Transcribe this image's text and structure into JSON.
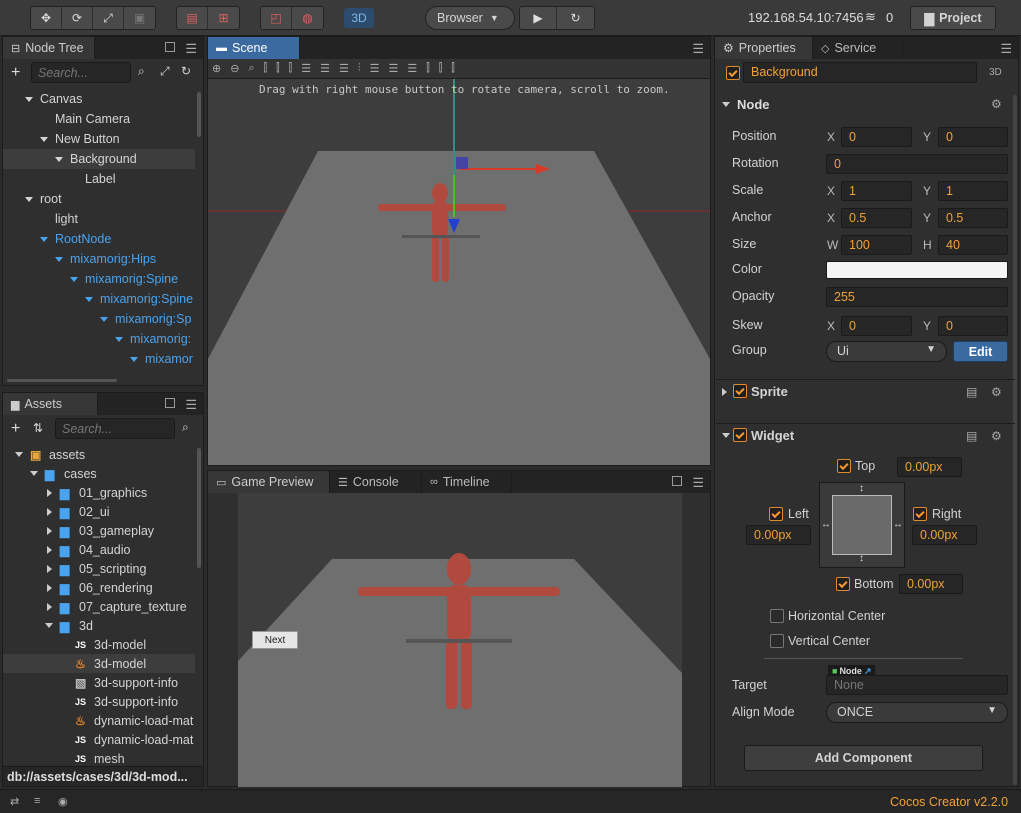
{
  "toolbar": {
    "browser_label": "Browser",
    "mode_3d": "3D",
    "ip": "192.168.54.10:7456",
    "device_count": "0",
    "project_label": "Project"
  },
  "node_tree": {
    "title": "Node Tree",
    "search_placeholder": "Search...",
    "items": [
      {
        "label": "Canvas",
        "depth": 1,
        "arrow": "down",
        "color": "#d4d4d4"
      },
      {
        "label": "Main Camera",
        "depth": 2,
        "arrow": "none",
        "color": "#d4d4d4"
      },
      {
        "label": "New Button",
        "depth": 2,
        "arrow": "down",
        "color": "#d4d4d4"
      },
      {
        "label": "Background",
        "depth": 3,
        "arrow": "down",
        "color": "#d4d4d4",
        "selected": true
      },
      {
        "label": "Label",
        "depth": 4,
        "arrow": "none",
        "color": "#d4d4d4"
      },
      {
        "label": "root",
        "depth": 1,
        "arrow": "down",
        "color": "#d4d4d4"
      },
      {
        "label": "light",
        "depth": 2,
        "arrow": "none",
        "color": "#d4d4d4"
      },
      {
        "label": "RootNode",
        "depth": 2,
        "arrow": "down",
        "color": "#4aa3ee"
      },
      {
        "label": "mixamorig:Hips",
        "depth": 3,
        "arrow": "down",
        "color": "#4aa3ee"
      },
      {
        "label": "mixamorig:Spine",
        "depth": 4,
        "arrow": "down",
        "color": "#4aa3ee"
      },
      {
        "label": "mixamorig:Spine",
        "depth": 5,
        "arrow": "down",
        "color": "#4aa3ee"
      },
      {
        "label": "mixamorig:Sp",
        "depth": 6,
        "arrow": "down",
        "color": "#4aa3ee"
      },
      {
        "label": "mixamorig:",
        "depth": 7,
        "arrow": "down",
        "color": "#4aa3ee"
      },
      {
        "label": "mixamor",
        "depth": 8,
        "arrow": "down",
        "color": "#4aa3ee"
      }
    ]
  },
  "assets": {
    "title": "Assets",
    "search_placeholder": "Search...",
    "path": "db://assets/cases/3d/3d-mod...",
    "items": [
      {
        "label": "assets",
        "depth": 1,
        "arrow": "down",
        "icon": "db"
      },
      {
        "label": "cases",
        "depth": 2,
        "arrow": "down",
        "icon": "folder"
      },
      {
        "label": "01_graphics",
        "depth": 3,
        "arrow": "right",
        "icon": "folder"
      },
      {
        "label": "02_ui",
        "depth": 3,
        "arrow": "right",
        "icon": "folder"
      },
      {
        "label": "03_gameplay",
        "depth": 3,
        "arrow": "right",
        "icon": "folder"
      },
      {
        "label": "04_audio",
        "depth": 3,
        "arrow": "right",
        "icon": "folder"
      },
      {
        "label": "05_scripting",
        "depth": 3,
        "arrow": "right",
        "icon": "folder"
      },
      {
        "label": "06_rendering",
        "depth": 3,
        "arrow": "right",
        "icon": "folder"
      },
      {
        "label": "07_capture_texture",
        "depth": 3,
        "arrow": "right",
        "icon": "folder"
      },
      {
        "label": "3d",
        "depth": 3,
        "arrow": "down",
        "icon": "folder"
      },
      {
        "label": "3d-model",
        "depth": 4,
        "arrow": "none",
        "icon": "js"
      },
      {
        "label": "3d-model",
        "depth": 4,
        "arrow": "none",
        "icon": "fire",
        "selected": true
      },
      {
        "label": "3d-support-info",
        "depth": 4,
        "arrow": "none",
        "icon": "prefab"
      },
      {
        "label": "3d-support-info",
        "depth": 4,
        "arrow": "none",
        "icon": "js"
      },
      {
        "label": "dynamic-load-mat",
        "depth": 4,
        "arrow": "none",
        "icon": "fire"
      },
      {
        "label": "dynamic-load-mat",
        "depth": 4,
        "arrow": "none",
        "icon": "js"
      },
      {
        "label": "mesh",
        "depth": 4,
        "arrow": "none",
        "icon": "js"
      }
    ]
  },
  "scene": {
    "title": "Scene",
    "hint": "Drag with right mouse button to rotate camera, scroll to zoom."
  },
  "bottom_tabs": {
    "game_preview": "Game Preview",
    "console": "Console",
    "timeline": "Timeline"
  },
  "game_preview": {
    "next_button": "Next"
  },
  "properties": {
    "tab": "Properties",
    "service_tab": "Service",
    "node_name": "Background",
    "mode": "3D",
    "node_section": "Node",
    "position": {
      "label": "Position",
      "x": "0",
      "y": "0"
    },
    "rotation": {
      "label": "Rotation",
      "value": "0"
    },
    "scale": {
      "label": "Scale",
      "x": "1",
      "y": "1"
    },
    "anchor": {
      "label": "Anchor",
      "x": "0.5",
      "y": "0.5"
    },
    "size": {
      "label": "Size",
      "w": "100",
      "h": "40"
    },
    "color": {
      "label": "Color",
      "value": "#f5f5f5"
    },
    "opacity": {
      "label": "Opacity",
      "value": "255"
    },
    "skew": {
      "label": "Skew",
      "x": "0",
      "y": "0"
    },
    "group": {
      "label": "Group",
      "value": "Ui",
      "edit": "Edit"
    },
    "axis": {
      "x": "X",
      "y": "Y",
      "w": "W",
      "h": "H"
    },
    "sprite_section": "Sprite",
    "widget_section": "Widget",
    "widget": {
      "top": "Top",
      "top_val": "0.00px",
      "left": "Left",
      "left_val": "0.00px",
      "right": "Right",
      "right_val": "0.00px",
      "bottom": "Bottom",
      "bottom_val": "0.00px",
      "hcenter": "Horizontal Center",
      "vcenter": "Vertical Center",
      "target_label": "Target",
      "target_tag": "Node",
      "target_value": "None",
      "align_label": "Align Mode",
      "align_value": "ONCE"
    },
    "add_component": "Add Component"
  },
  "status": {
    "version": "Cocos Creator v2.2.0"
  },
  "colors": {
    "accent_orange": "#f0a23a",
    "link_blue": "#4aa3ee",
    "panel": "#2f2f2f",
    "selected_tab": "#3b6aa0"
  }
}
